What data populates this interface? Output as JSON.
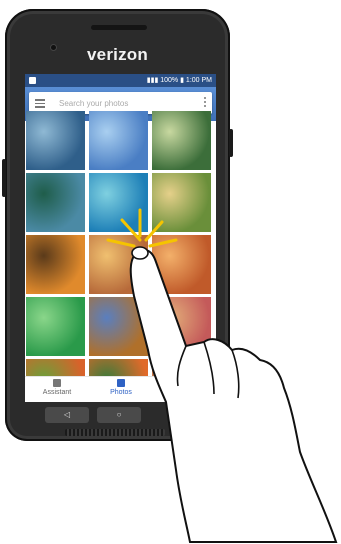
{
  "device": {
    "brand": "verizon"
  },
  "status_bar": {
    "battery": "100%",
    "time": "1:00 PM"
  },
  "search": {
    "placeholder": "Search your photos"
  },
  "photos": [
    {
      "colors": [
        "#2f5f8a",
        "#8fb9d4"
      ]
    },
    {
      "colors": [
        "#4a7ec4",
        "#a9cff0"
      ]
    },
    {
      "colors": [
        "#3c6e3a",
        "#c8d8a0"
      ]
    },
    {
      "colors": [
        "#4b8aa5",
        "#1f5d4a"
      ]
    },
    {
      "colors": [
        "#1d7fb7",
        "#7fd0e0"
      ]
    },
    {
      "colors": [
        "#6a8f3a",
        "#e5d08a"
      ]
    },
    {
      "colors": [
        "#e08a2c",
        "#5a3a1a"
      ]
    },
    {
      "colors": [
        "#b76a3a",
        "#f0c070"
      ]
    },
    {
      "colors": [
        "#c05a2a",
        "#f3b06a"
      ]
    },
    {
      "colors": [
        "#2a9a4a",
        "#8ad68a"
      ]
    },
    {
      "colors": [
        "#b0702a",
        "#5a7fbf"
      ]
    },
    {
      "colors": [
        "#c45a5a",
        "#e3b07a"
      ]
    },
    {
      "colors": [
        "#d8622a",
        "#6aa03a"
      ]
    },
    {
      "colors": [
        "#e06a2a",
        "#3a7a3a"
      ]
    },
    {
      "colors": [
        "#e8a060",
        "#a85a3a"
      ]
    }
  ],
  "bottom_nav": {
    "items": [
      {
        "label": "Assistant"
      },
      {
        "label": "Photos"
      },
      {
        "label": ""
      }
    ]
  },
  "hardware_keys": {
    "back": "◁",
    "home": "○"
  }
}
